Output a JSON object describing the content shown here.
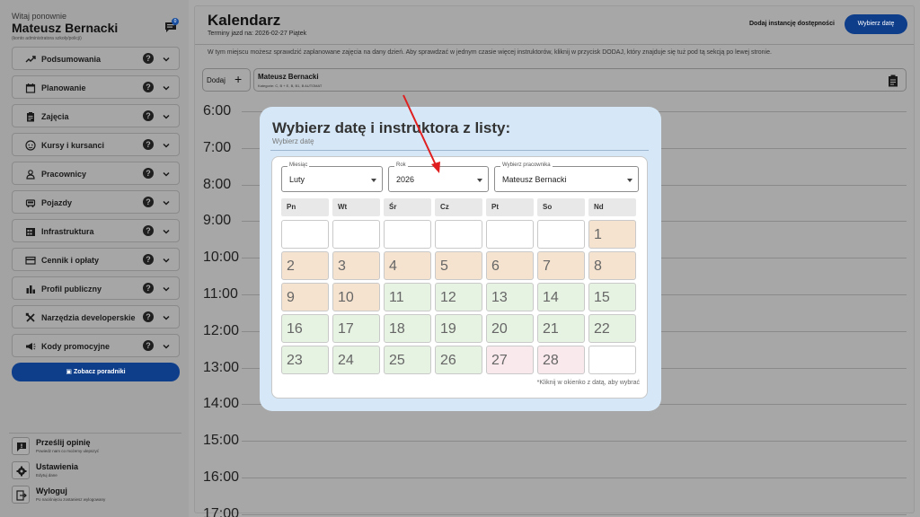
{
  "sidebar": {
    "welcome": "Witaj ponownie",
    "user_name": "Mateusz Bernacki",
    "user_role": "(konto administratora szkoły/policji)",
    "chat_badge": "0",
    "items": [
      {
        "label": "Podsumowania",
        "icon": "trend-icon"
      },
      {
        "label": "Planowanie",
        "icon": "calendar-icon"
      },
      {
        "label": "Zajęcia",
        "icon": "clipboard-icon"
      },
      {
        "label": "Kursy i kursanci",
        "icon": "face-icon"
      },
      {
        "label": "Pracownicy",
        "icon": "person-icon"
      },
      {
        "label": "Pojazdy",
        "icon": "car-icon"
      },
      {
        "label": "Infrastruktura",
        "icon": "building-icon"
      },
      {
        "label": "Cennik i opłaty",
        "icon": "card-icon"
      },
      {
        "label": "Profil publiczny",
        "icon": "bar-chart-icon"
      },
      {
        "label": "Narzędzia developerskie",
        "icon": "tools-icon"
      },
      {
        "label": "Kody promocyjne",
        "icon": "megaphone-icon"
      }
    ],
    "help_glyph": "?",
    "tutorials_button": "Zobacz poradniki",
    "footer": [
      {
        "title": "Prześlij opinię",
        "subtitle": "Powiedz nam co możemy ulepszyć"
      },
      {
        "title": "Ustawienia",
        "subtitle": "Edytuj dane"
      },
      {
        "title": "Wyloguj",
        "subtitle": "Po naciśnięciu zostaniesz wylogowany"
      }
    ]
  },
  "main": {
    "title": "Kalendarz",
    "subtitle": "Terminy jazd na: 2026-02-27 Piątek",
    "add_availability": "Dodaj instancję dostępności",
    "choose_date_button": "Wybierz datę",
    "info": "W tym miejscu możesz sprawdzić zaplanowane zajęcia na dany dzień. Aby sprawdzać w jednym czasie więcej instruktorów, kliknij w przycisk DODAJ, który znajduje się tuż pod tą sekcją po lewej stronie.",
    "add_label": "Dodaj",
    "add_plus": "+",
    "instructor_name": "Mateusz Bernacki",
    "instructor_categories": "Kategorie: C, B + E, B, B1, B AUTOMAT",
    "hours": [
      "6:00",
      "7:00",
      "8:00",
      "9:00",
      "10:00",
      "11:00",
      "12:00",
      "13:00",
      "14:00",
      "15:00",
      "16:00",
      "17:00"
    ]
  },
  "modal": {
    "title": "Wybierz datę i instruktora z listy:",
    "subtitle": "Wybierz datę",
    "month_label": "Miesiąc",
    "month_value": "Luty",
    "year_label": "Rok",
    "year_value": "2026",
    "employee_label": "Wybierz pracownika",
    "employee_value": "Mateusz Bernacki",
    "weekdays": [
      "Pn",
      "Wt",
      "Śr",
      "Cz",
      "Pt",
      "So",
      "Nd"
    ],
    "days": [
      {
        "label": "",
        "state": "empty"
      },
      {
        "label": "",
        "state": "empty"
      },
      {
        "label": "",
        "state": "empty"
      },
      {
        "label": "",
        "state": "empty"
      },
      {
        "label": "",
        "state": "empty"
      },
      {
        "label": "",
        "state": "empty"
      },
      {
        "label": "1",
        "state": "orange"
      },
      {
        "label": "2",
        "state": "orange"
      },
      {
        "label": "3",
        "state": "orange"
      },
      {
        "label": "4",
        "state": "orange"
      },
      {
        "label": "5",
        "state": "orange"
      },
      {
        "label": "6",
        "state": "orange"
      },
      {
        "label": "7",
        "state": "orange"
      },
      {
        "label": "8",
        "state": "orange"
      },
      {
        "label": "9",
        "state": "orange"
      },
      {
        "label": "10",
        "state": "orange"
      },
      {
        "label": "11",
        "state": "green"
      },
      {
        "label": "12",
        "state": "green"
      },
      {
        "label": "13",
        "state": "green"
      },
      {
        "label": "14",
        "state": "green"
      },
      {
        "label": "15",
        "state": "green"
      },
      {
        "label": "16",
        "state": "green"
      },
      {
        "label": "17",
        "state": "green"
      },
      {
        "label": "18",
        "state": "green"
      },
      {
        "label": "19",
        "state": "green"
      },
      {
        "label": "20",
        "state": "green"
      },
      {
        "label": "21",
        "state": "green"
      },
      {
        "label": "22",
        "state": "green"
      },
      {
        "label": "23",
        "state": "green"
      },
      {
        "label": "24",
        "state": "green"
      },
      {
        "label": "25",
        "state": "green"
      },
      {
        "label": "26",
        "state": "green"
      },
      {
        "label": "27",
        "state": "pink"
      },
      {
        "label": "28",
        "state": "pink"
      },
      {
        "label": "",
        "state": "empty"
      }
    ],
    "hint": "*Kliknij w okienko z datą, aby wybrać"
  },
  "colors": {
    "primary": "#0e3d8a",
    "modal_bg": "#d6e8f7",
    "past_day": "#f5e3cf",
    "available_day": "#e6f2e2",
    "today_day": "#f9e9ec",
    "annotation_arrow": "#e02020"
  }
}
